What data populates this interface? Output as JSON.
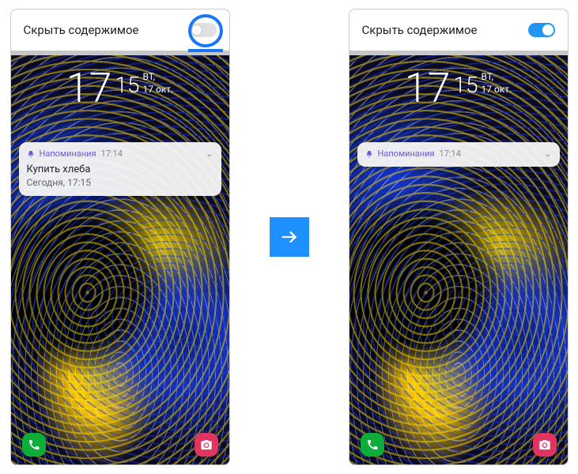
{
  "left": {
    "header_label": "Скрыть содержимое",
    "toggle_on": false,
    "clock": {
      "hours": "17",
      "mins": "15",
      "dow": "ВТ,",
      "date": "17 окт."
    },
    "notification": {
      "app": "Напоминания",
      "time": "17:14",
      "title": "Купить хлеба",
      "subtitle": "Сегодня, 17:15"
    }
  },
  "right": {
    "header_label": "Скрыть содержимое",
    "toggle_on": true,
    "clock": {
      "hours": "17",
      "mins": "15",
      "dow": "ВТ,",
      "date": "17 окт."
    },
    "notification": {
      "app": "Напоминания",
      "time": "17:14"
    }
  }
}
